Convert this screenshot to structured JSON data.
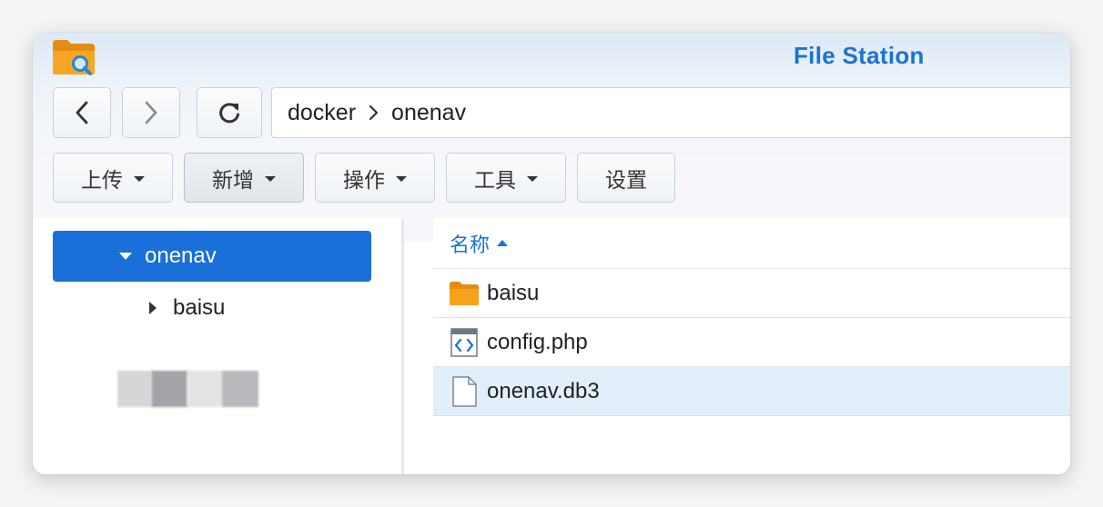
{
  "window": {
    "title": "File Station"
  },
  "nav": {
    "back_icon": "chevron-left-icon",
    "forward_icon": "chevron-right-icon",
    "refresh_icon": "refresh-icon",
    "path": [
      "docker",
      "onenav"
    ]
  },
  "toolbar": {
    "upload": "上传",
    "create": "新增",
    "action": "操作",
    "tools": "工具",
    "settings": "设置"
  },
  "tree": {
    "selected": "onenav",
    "child": "baisu"
  },
  "file_list": {
    "column_name": "名称",
    "sort": "ascending",
    "rows": [
      {
        "name": "baisu",
        "icon": "folder-icon"
      },
      {
        "name": "config.php",
        "icon": "code-file-icon"
      },
      {
        "name": "onenav.db3",
        "icon": "file-icon",
        "selected": true
      }
    ]
  },
  "colors": {
    "accent": "#1a73d2",
    "selection": "#1a6fd8",
    "row_highlight": "#e2effa",
    "folder": "#f7a21b"
  }
}
